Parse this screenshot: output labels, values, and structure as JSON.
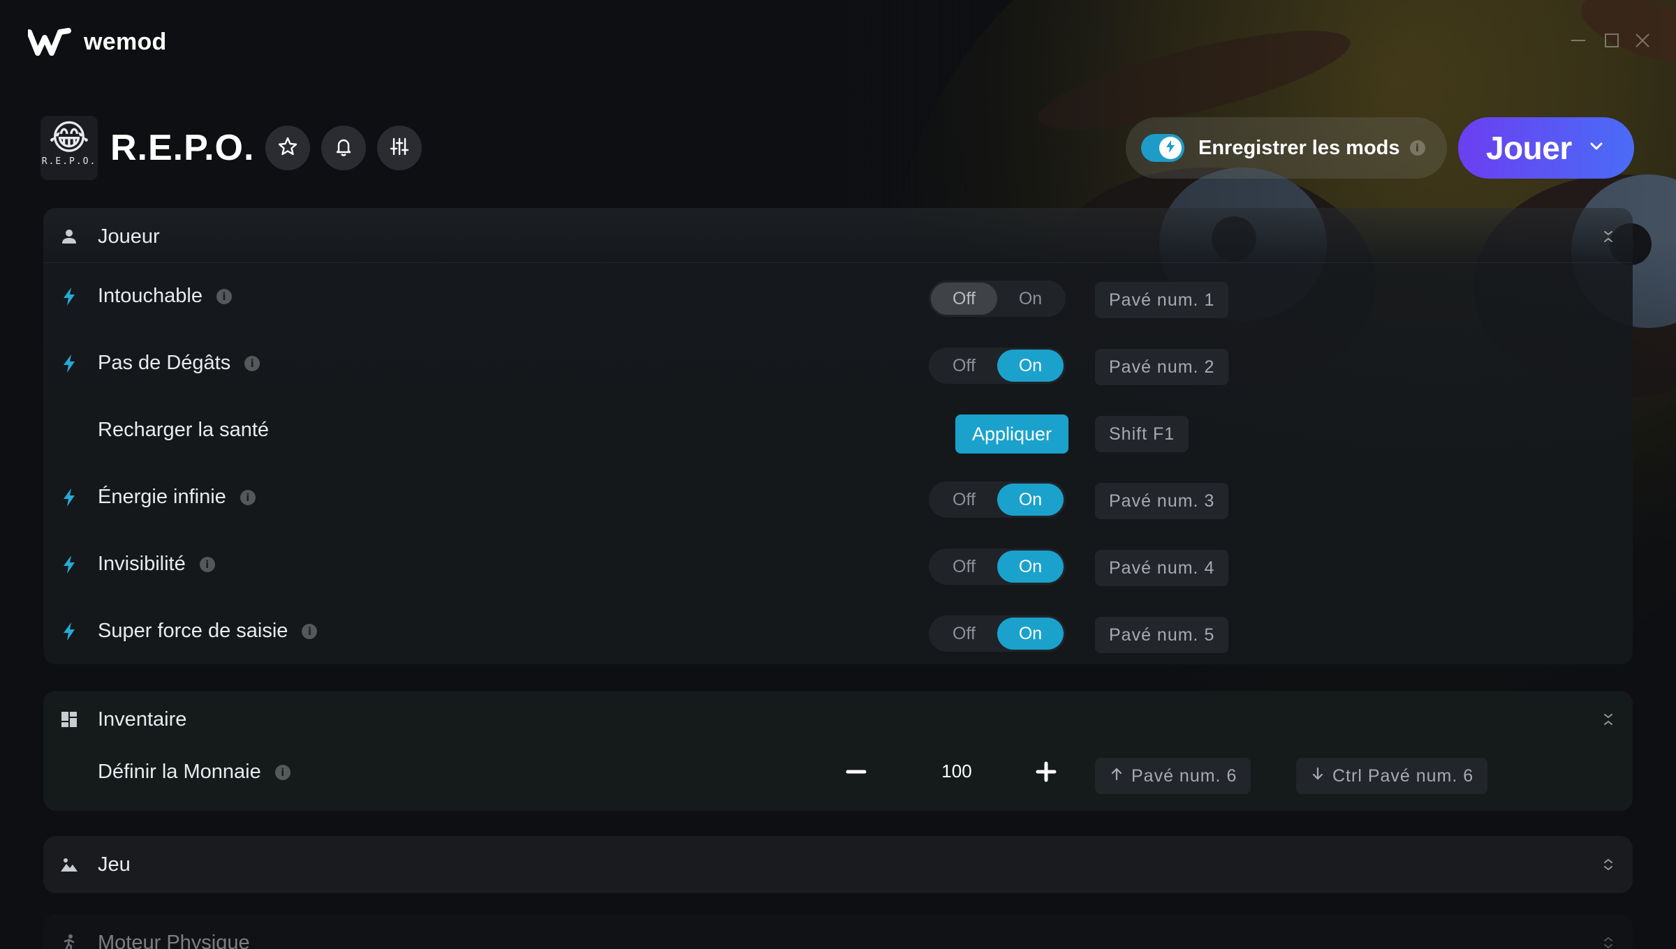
{
  "app": {
    "name": "wemod"
  },
  "game": {
    "title": "R.E.P.O.",
    "thumb_caption": "R.E.P.O."
  },
  "header": {
    "save_mods_label": "Enregistrer les mods",
    "save_mods_info": "i",
    "save_mods_enabled": true,
    "play_label": "Jouer"
  },
  "sections": {
    "joueur": {
      "title": "Joueur",
      "rows": [
        {
          "label": "Intouchable",
          "info": "i",
          "off": "Off",
          "on": "On",
          "state": "off",
          "hotkey": "Pavé num. 1"
        },
        {
          "label": "Pas de Dégâts",
          "info": "i",
          "off": "Off",
          "on": "On",
          "state": "on",
          "hotkey": "Pavé num. 2"
        },
        {
          "label": "Recharger la santé",
          "action": "Appliquer",
          "hotkey": "Shift F1"
        },
        {
          "label": "Énergie infinie",
          "info": "i",
          "off": "Off",
          "on": "On",
          "state": "on",
          "hotkey": "Pavé num. 3"
        },
        {
          "label": "Invisibilité",
          "info": "i",
          "off": "Off",
          "on": "On",
          "state": "on",
          "hotkey": "Pavé num. 4"
        },
        {
          "label": "Super force de saisie",
          "info": "i",
          "off": "Off",
          "on": "On",
          "state": "on",
          "hotkey": "Pavé num. 5"
        }
      ]
    },
    "inventaire": {
      "title": "Inventaire",
      "rows": [
        {
          "label": "Définir la Monnaie",
          "info": "i",
          "value": "100",
          "hotkey_up": "Pavé num. 6",
          "hotkey_down": "Ctrl Pavé num. 6"
        }
      ]
    },
    "jeu": {
      "title": "Jeu"
    },
    "moteur": {
      "title": "Moteur Physique"
    }
  },
  "colors": {
    "accent": "#1aa2cc",
    "play_gradient_start": "#6b3ff0",
    "play_gradient_end": "#4a6cf7",
    "background": "#0d0f12"
  },
  "icons": {
    "logo": "wemod-logo-icon",
    "favorite": "star-icon",
    "notifications": "bell-icon",
    "settings": "sliders-icon",
    "play_menu": "chevron-down-icon",
    "joueur": "user-icon",
    "inventaire": "grid-icon",
    "jeu": "landscape-icon",
    "moteur": "running-icon",
    "mod": "lightning-bolt-icon"
  }
}
